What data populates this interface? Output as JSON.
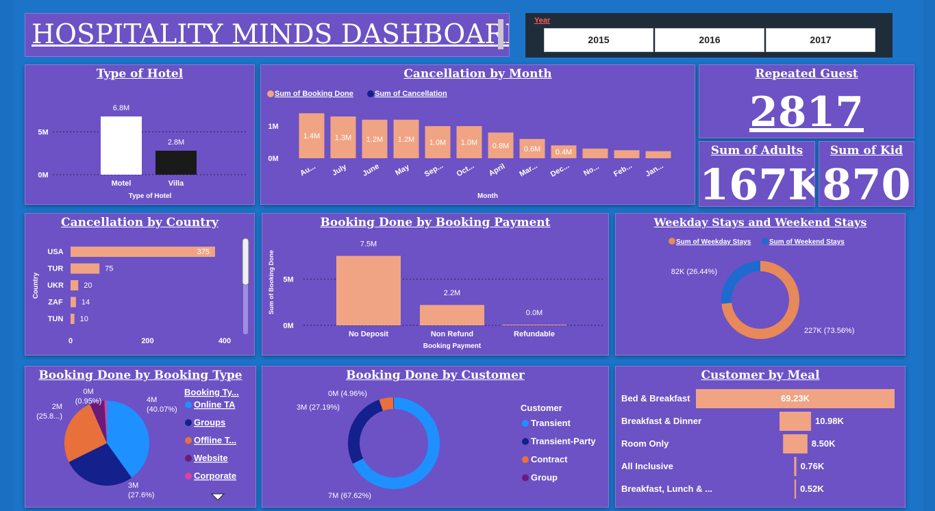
{
  "title": "HOSPITALITY MINDS DASHBOARD",
  "year_slicer": {
    "label": "Year",
    "options": [
      "2015",
      "2016",
      "2017"
    ]
  },
  "cards": {
    "repeated_guest": {
      "title": "Repeated Guest",
      "value": "2817"
    },
    "adults": {
      "title": "Sum of Adults",
      "value": "167K"
    },
    "kids": {
      "title": "Sum of Kid",
      "value": "870"
    }
  },
  "colors": {
    "peach": "#f0a484",
    "navy": "#14208c",
    "blue": "#1e90ff",
    "orange": "#e8703a",
    "purple": "#6a1b7a",
    "pink": "#e040a0",
    "card": "#6c52c4"
  },
  "chart_data": [
    {
      "id": "type_of_hotel",
      "type": "bar",
      "title": "Type of Hotel",
      "categories": [
        "Motel",
        "Villa"
      ],
      "values": [
        6.8,
        2.8
      ],
      "unit": "M",
      "data_labels": [
        "6.8M",
        "2.8M"
      ],
      "bar_colors": [
        "#ffffff",
        "#1a1a1a"
      ],
      "xlabel": "Type of Hotel",
      "ylabel": "",
      "yticks": [
        "0M",
        "5M"
      ],
      "ylim": [
        0,
        8
      ]
    },
    {
      "id": "cancellation_by_month",
      "type": "bar",
      "title": "Cancellation by Month",
      "categories": [
        "Au...",
        "July",
        "June",
        "May",
        "Sep...",
        "Oct...",
        "April",
        "Mar...",
        "Dec...",
        "No...",
        "Feb...",
        "Jan..."
      ],
      "series": [
        {
          "name": "Sum of Booking Done",
          "values": [
            1.4,
            1.3,
            1.2,
            1.2,
            1.0,
            1.0,
            0.8,
            0.6,
            0.4,
            0.3,
            0.25,
            0.22
          ],
          "unit": "M"
        },
        {
          "name": "Sum of Cancellation",
          "values": []
        }
      ],
      "data_labels": [
        "1.4M",
        "1.3M",
        "1.2M",
        "1.2M",
        "1.0M",
        "1.0M",
        "0.8M",
        "0.6M",
        "0.4M",
        "",
        "",
        ""
      ],
      "xlabel": "Month",
      "ylabel": "",
      "yticks": [
        "0M",
        "1M"
      ],
      "ylim": [
        0,
        1.6
      ]
    },
    {
      "id": "cancellation_by_country",
      "type": "bar",
      "orientation": "horizontal",
      "title": "Cancellation by Country",
      "categories": [
        "USA",
        "TUR",
        "UKR",
        "ZAF",
        "TUN"
      ],
      "values": [
        375,
        75,
        20,
        14,
        10
      ],
      "ylabel": "Country",
      "xticks": [
        "0",
        "200",
        "400"
      ],
      "xlim": [
        0,
        400
      ]
    },
    {
      "id": "booking_by_payment",
      "type": "bar",
      "title": "Booking Done by Booking Payment",
      "categories": [
        "No Deposit",
        "Non Refund",
        "Refundable"
      ],
      "values": [
        7.5,
        2.2,
        0.02
      ],
      "unit": "M",
      "data_labels": [
        "7.5M",
        "2.2M",
        "0.0M"
      ],
      "xlabel": "Booking Payment",
      "ylabel": "Sum of Booking Done",
      "yticks": [
        "0M",
        "5M"
      ],
      "ylim": [
        0,
        8.5
      ]
    },
    {
      "id": "weekday_weekend",
      "type": "pie",
      "donut": true,
      "title": "Weekday Stays and Weekend Stays",
      "series": [
        {
          "name": "Sum of Weekday Stays",
          "value": 227,
          "label": "227K (73.56%)",
          "color": "#e8895a"
        },
        {
          "name": "Sum of Weekend Stays",
          "value": 82,
          "label": "82K (26.44%)",
          "color": "#1e6ad0"
        }
      ]
    },
    {
      "id": "booking_by_type",
      "type": "pie",
      "title": "Booking Done by Booking Type",
      "legend_title": "Booking Ty...",
      "series": [
        {
          "name": "Online TA",
          "value": 40.07,
          "label": "4M\n(40.07%)",
          "color": "#1e90ff"
        },
        {
          "name": "Groups",
          "value": 27.6,
          "label": "3M\n(27.6%)",
          "color": "#14208c"
        },
        {
          "name": "Offline T...",
          "value": 25.8,
          "label": "2M\n(25.8...)",
          "color": "#e8703a"
        },
        {
          "name": "Website",
          "value": 5.58,
          "label": "",
          "color": "#6a1b7a"
        },
        {
          "name": "Corporate",
          "value": 0.95,
          "label": "0M\n(0.95%)",
          "color": "#e040a0"
        }
      ]
    },
    {
      "id": "booking_by_customer",
      "type": "pie",
      "donut": true,
      "title": "Booking Done by Customer",
      "legend_title": "Customer",
      "series": [
        {
          "name": "Transient",
          "value": 67.62,
          "label": "7M (67.62%)",
          "color": "#1e90ff"
        },
        {
          "name": "Transient-Party",
          "value": 27.19,
          "label": "3M (27.19%)",
          "color": "#14208c"
        },
        {
          "name": "Contract",
          "value": 4.96,
          "label": "0M (4.96%)",
          "color": "#e8703a"
        },
        {
          "name": "Group",
          "value": 0.23,
          "label": "",
          "color": "#6a1b7a"
        }
      ]
    },
    {
      "id": "customer_by_meal",
      "type": "bar",
      "orientation": "horizontal",
      "title": "Customer by Meal",
      "categories": [
        "Bed & Breakfast",
        "Breakfast & Dinner",
        "Room Only",
        "All Inclusive",
        "Breakfast, Lunch & ..."
      ],
      "values": [
        69.23,
        10.98,
        8.5,
        0.76,
        0.52
      ],
      "unit": "K",
      "data_labels": [
        "69.23K",
        "10.98K",
        "8.50K",
        "0.76K",
        "0.52K"
      ]
    }
  ]
}
